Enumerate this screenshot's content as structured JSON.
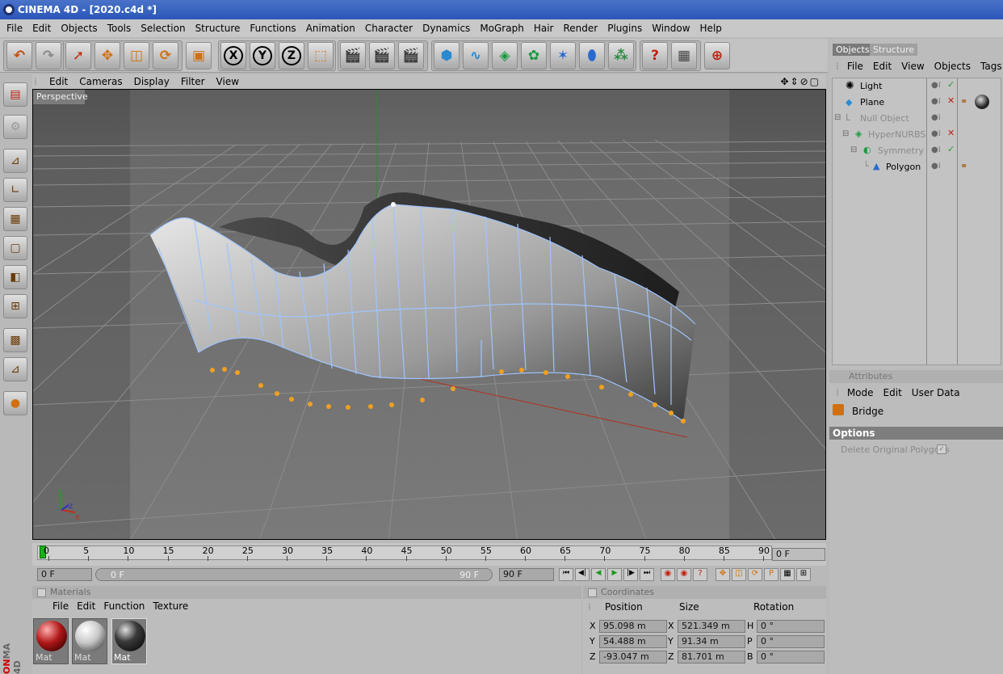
{
  "window": {
    "title": "CINEMA 4D - [2020.c4d *]"
  },
  "menu": [
    "File",
    "Edit",
    "Objects",
    "Tools",
    "Selection",
    "Structure",
    "Functions",
    "Animation",
    "Character",
    "Dynamics",
    "MoGraph",
    "Hair",
    "Render",
    "Plugins",
    "Window",
    "Help"
  ],
  "toolbar": {
    "x_label": "X",
    "y_label": "Y",
    "z_label": "Z"
  },
  "viewport": {
    "menu": [
      "Edit",
      "Cameras",
      "Display",
      "Filter",
      "View"
    ],
    "label": "Perspective",
    "axis": {
      "y": "y",
      "z": "z",
      "x": "x"
    }
  },
  "timeline": {
    "ticks": [
      "0",
      "5",
      "10",
      "15",
      "20",
      "25",
      "30",
      "35",
      "40",
      "45",
      "50",
      "55",
      "60",
      "65",
      "70",
      "75",
      "80",
      "85",
      "90"
    ],
    "current_frame": "0 F"
  },
  "transport": {
    "start": "0 F",
    "range_start": "0 F",
    "range_end": "90 F",
    "end": "90 F"
  },
  "materials": {
    "header": "Materials",
    "menu": [
      "File",
      "Edit",
      "Function",
      "Texture"
    ],
    "items": [
      {
        "label": "Mat",
        "color": "#b01818"
      },
      {
        "label": "Mat",
        "color": "#d8d8d8"
      },
      {
        "label": "Mat",
        "color": "#3a3a3a"
      }
    ]
  },
  "coordinates": {
    "header": "Coordinates",
    "col_position": "Position",
    "col_size": "Size",
    "col_rotation": "Rotation",
    "rows": [
      {
        "axis": "X",
        "pos": "95.098 m",
        "size_axis": "X",
        "size": "521.349 m",
        "rot_axis": "H",
        "rot": "0 °"
      },
      {
        "axis": "Y",
        "pos": "54.488 m",
        "size_axis": "Y",
        "size": "91.34 m",
        "rot_axis": "P",
        "rot": "0 °"
      },
      {
        "axis": "Z",
        "pos": "-93.047 m",
        "size_axis": "Z",
        "size": "81.701 m",
        "rot_axis": "B",
        "rot": "0 °"
      }
    ]
  },
  "objects_panel": {
    "tabs": [
      "Objects",
      "Structure"
    ],
    "menu": [
      "File",
      "Edit",
      "View",
      "Objects",
      "Tags"
    ],
    "items": [
      {
        "name": "Light",
        "indent": 0,
        "dim": false
      },
      {
        "name": "Plane",
        "indent": 0,
        "dim": false
      },
      {
        "name": "Null Object",
        "indent": 0,
        "dim": true
      },
      {
        "name": "HyperNURBS",
        "indent": 1,
        "dim": true
      },
      {
        "name": "Symmetry",
        "indent": 2,
        "dim": true
      },
      {
        "name": "Polygon",
        "indent": 3,
        "dim": false
      }
    ]
  },
  "attributes": {
    "header": "Attributes",
    "menu": [
      "Mode",
      "Edit",
      "User Data"
    ],
    "tool_name": "Bridge",
    "section": "Options",
    "option_label": "Delete Original Polygons"
  },
  "watermark": "MA 4D",
  "watermark_prefix": "ON"
}
